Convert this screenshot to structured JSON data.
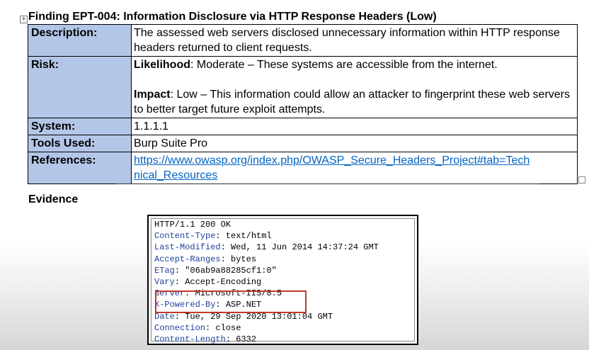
{
  "finding": {
    "title": "Finding EPT-004: Information Disclosure via HTTP Response Headers (Low)",
    "labels": {
      "description": "Description:",
      "risk": "Risk:",
      "system": "System:",
      "tools": "Tools Used:",
      "references": "References:"
    },
    "description": "The assessed web servers disclosed unnecessary information within HTTP response headers returned to client requests.",
    "risk": {
      "likelihood_label": "Likelihood",
      "likelihood_text": ": Moderate – These systems are accessible from the internet.",
      "impact_label": "Impact",
      "impact_text": ": Low – This information could allow an attacker to fingerprint these web servers to better target future exploit attempts."
    },
    "system": "1.1.1.1",
    "tools": "Burp Suite Pro",
    "reference_url_line1": "https://www.owasp.org/index.php/OWASP_Secure_Headers_Project#tab=Tech",
    "reference_url_line2": "nical_Resources"
  },
  "evidence": {
    "heading": "Evidence",
    "status_line": "HTTP/1.1 200 OK",
    "headers": [
      {
        "name": "Content-Type",
        "value": ": text/html"
      },
      {
        "name": "Last-Modified",
        "value": ": Wed, 11 Jun 2014 14:37:24 GMT"
      },
      {
        "name": "Accept-Ranges",
        "value": ": bytes"
      },
      {
        "name": "ETag",
        "value": ": \"06ab9a88285cf1:0\""
      },
      {
        "name": "Vary",
        "value": ": Accept-Encoding"
      },
      {
        "name": "Server",
        "value": ": Microsoft-IIS/8.5"
      },
      {
        "name": "X-Powered-By",
        "value": ": ASP.NET"
      },
      {
        "name": "Date",
        "value": ": Tue, 29 Sep 2020 13:01:04 GMT"
      },
      {
        "name": "Connection",
        "value": ": close"
      },
      {
        "name": "Content-Length",
        "value": ": 6332"
      }
    ]
  },
  "colors": {
    "label_cell_bg": "#b4c6e7",
    "link": "#0563c1",
    "header_name": "#1f3f99",
    "highlight": "#c0392b"
  }
}
